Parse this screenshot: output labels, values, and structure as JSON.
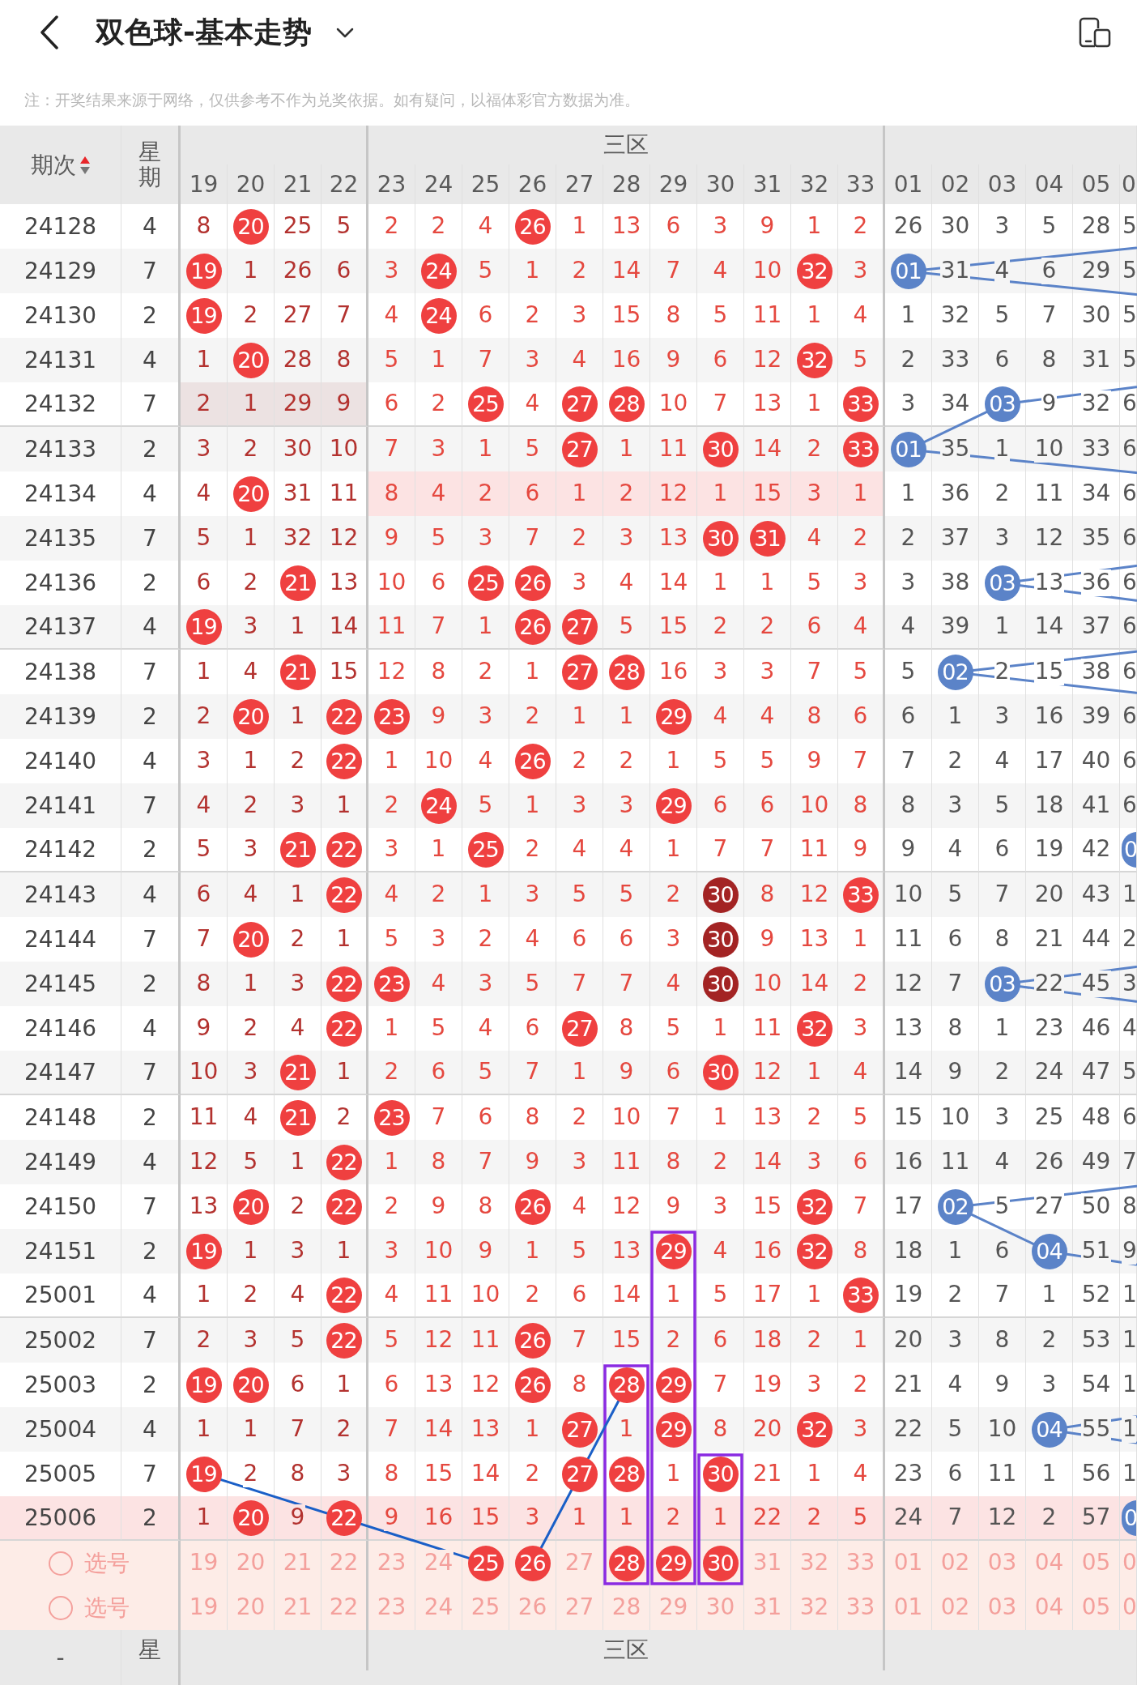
{
  "header": {
    "title": "双色球-基本走势"
  },
  "note": "注：开奖结果来源于网络，仅供参考不作为兑奖依据。如有疑问，以福体彩官方数据为准。",
  "table": {
    "columns": {
      "issue": "期次",
      "sort_ascending": true,
      "weekday": "星期",
      "zone": "三区",
      "red": [
        "19",
        "20",
        "21",
        "22",
        "23",
        "24",
        "25",
        "26",
        "27",
        "28",
        "29",
        "30",
        "31",
        "32",
        "33"
      ],
      "blue": [
        "01",
        "02",
        "03",
        "04",
        "05",
        "0"
      ]
    },
    "rows": [
      {
        "issue": "24128",
        "weekday": "4",
        "red": [
          "8",
          "20",
          "25",
          "5",
          "2",
          "2",
          "4",
          "26",
          "1",
          "13",
          "6",
          "3",
          "9",
          "1",
          "2"
        ],
        "red_hits": [
          false,
          true,
          false,
          false,
          false,
          false,
          false,
          true,
          false,
          false,
          false,
          false,
          false,
          false,
          false
        ],
        "blue": [
          "26",
          "30",
          "3",
          "5",
          "28",
          "5"
        ],
        "blue_hits": [
          false,
          false,
          false,
          false,
          false,
          false
        ],
        "highlight_a": false,
        "highlight_b": false,
        "highlight_row": false
      },
      {
        "issue": "24129",
        "weekday": "7",
        "red": [
          "19",
          "1",
          "26",
          "6",
          "3",
          "24",
          "5",
          "1",
          "2",
          "14",
          "7",
          "4",
          "10",
          "32",
          "3"
        ],
        "red_hits": [
          true,
          false,
          false,
          false,
          false,
          true,
          false,
          false,
          false,
          false,
          false,
          false,
          false,
          true,
          false
        ],
        "blue": [
          "01",
          "31",
          "4",
          "6",
          "29",
          "5"
        ],
        "blue_hits": [
          true,
          false,
          false,
          false,
          false,
          false
        ],
        "highlight_a": false,
        "highlight_b": false,
        "highlight_row": false
      },
      {
        "issue": "24130",
        "weekday": "2",
        "red": [
          "19",
          "2",
          "27",
          "7",
          "4",
          "24",
          "6",
          "2",
          "3",
          "15",
          "8",
          "5",
          "11",
          "1",
          "4"
        ],
        "red_hits": [
          true,
          false,
          false,
          false,
          false,
          true,
          false,
          false,
          false,
          false,
          false,
          false,
          false,
          false,
          false
        ],
        "blue": [
          "1",
          "32",
          "5",
          "7",
          "30",
          "5"
        ],
        "blue_hits": [
          false,
          false,
          false,
          false,
          false,
          false
        ],
        "highlight_a": false,
        "highlight_b": false,
        "highlight_row": false
      },
      {
        "issue": "24131",
        "weekday": "4",
        "red": [
          "1",
          "20",
          "28",
          "8",
          "5",
          "1",
          "7",
          "3",
          "4",
          "16",
          "9",
          "6",
          "12",
          "32",
          "5"
        ],
        "red_hits": [
          false,
          true,
          false,
          false,
          false,
          false,
          false,
          false,
          false,
          false,
          false,
          false,
          false,
          true,
          false
        ],
        "blue": [
          "2",
          "33",
          "6",
          "8",
          "31",
          "5"
        ],
        "blue_hits": [
          false,
          false,
          false,
          false,
          false,
          false
        ],
        "highlight_a": false,
        "highlight_b": false,
        "highlight_row": false
      },
      {
        "issue": "24132",
        "weekday": "7",
        "red": [
          "2",
          "1",
          "29",
          "9",
          "6",
          "2",
          "25",
          "4",
          "27",
          "28",
          "10",
          "7",
          "13",
          "1",
          "33"
        ],
        "red_hits": [
          false,
          false,
          false,
          false,
          false,
          false,
          true,
          false,
          true,
          true,
          false,
          false,
          false,
          false,
          true
        ],
        "blue": [
          "3",
          "34",
          "03",
          "9",
          "32",
          "6"
        ],
        "blue_hits": [
          false,
          false,
          true,
          false,
          false,
          false
        ],
        "highlight_a": true,
        "highlight_b": false,
        "highlight_row": false
      },
      {
        "issue": "24133",
        "weekday": "2",
        "red": [
          "3",
          "2",
          "30",
          "10",
          "7",
          "3",
          "1",
          "5",
          "27",
          "1",
          "11",
          "30",
          "14",
          "2",
          "33"
        ],
        "red_hits": [
          false,
          false,
          false,
          false,
          false,
          false,
          false,
          false,
          true,
          false,
          false,
          true,
          false,
          false,
          true
        ],
        "blue": [
          "01",
          "35",
          "1",
          "10",
          "33",
          "6"
        ],
        "blue_hits": [
          true,
          false,
          false,
          false,
          false,
          false
        ],
        "highlight_a": false,
        "highlight_b": false,
        "highlight_row": false
      },
      {
        "issue": "24134",
        "weekday": "4",
        "red": [
          "4",
          "20",
          "31",
          "11",
          "8",
          "4",
          "2",
          "6",
          "1",
          "2",
          "12",
          "1",
          "15",
          "3",
          "1"
        ],
        "red_hits": [
          false,
          true,
          false,
          false,
          false,
          false,
          false,
          false,
          false,
          false,
          false,
          false,
          false,
          false,
          false
        ],
        "blue": [
          "1",
          "36",
          "2",
          "11",
          "34",
          "6"
        ],
        "blue_hits": [
          false,
          false,
          false,
          false,
          false,
          false
        ],
        "highlight_a": false,
        "highlight_b": true,
        "highlight_row": false
      },
      {
        "issue": "24135",
        "weekday": "7",
        "red": [
          "5",
          "1",
          "32",
          "12",
          "9",
          "5",
          "3",
          "7",
          "2",
          "3",
          "13",
          "30",
          "31",
          "4",
          "2"
        ],
        "red_hits": [
          false,
          false,
          false,
          false,
          false,
          false,
          false,
          false,
          false,
          false,
          false,
          true,
          true,
          false,
          false
        ],
        "blue": [
          "2",
          "37",
          "3",
          "12",
          "35",
          "6"
        ],
        "blue_hits": [
          false,
          false,
          false,
          false,
          false,
          false
        ],
        "highlight_a": false,
        "highlight_b": false,
        "highlight_row": false
      },
      {
        "issue": "24136",
        "weekday": "2",
        "red": [
          "6",
          "2",
          "21",
          "13",
          "10",
          "6",
          "25",
          "26",
          "3",
          "4",
          "14",
          "1",
          "1",
          "5",
          "3"
        ],
        "red_hits": [
          false,
          false,
          true,
          false,
          false,
          false,
          true,
          true,
          false,
          false,
          false,
          false,
          false,
          false,
          false
        ],
        "blue": [
          "3",
          "38",
          "03",
          "13",
          "36",
          "6"
        ],
        "blue_hits": [
          false,
          false,
          true,
          false,
          false,
          false
        ],
        "highlight_a": false,
        "highlight_b": false,
        "highlight_row": false
      },
      {
        "issue": "24137",
        "weekday": "4",
        "red": [
          "19",
          "3",
          "1",
          "14",
          "11",
          "7",
          "1",
          "26",
          "27",
          "5",
          "15",
          "2",
          "2",
          "6",
          "4"
        ],
        "red_hits": [
          true,
          false,
          false,
          false,
          false,
          false,
          false,
          true,
          true,
          false,
          false,
          false,
          false,
          false,
          false
        ],
        "blue": [
          "4",
          "39",
          "1",
          "14",
          "37",
          "6"
        ],
        "blue_hits": [
          false,
          false,
          false,
          false,
          false,
          false
        ],
        "highlight_a": false,
        "highlight_b": false,
        "highlight_row": false
      },
      {
        "issue": "24138",
        "weekday": "7",
        "red": [
          "1",
          "4",
          "21",
          "15",
          "12",
          "8",
          "2",
          "1",
          "27",
          "28",
          "16",
          "3",
          "3",
          "7",
          "5"
        ],
        "red_hits": [
          false,
          false,
          true,
          false,
          false,
          false,
          false,
          false,
          true,
          true,
          false,
          false,
          false,
          false,
          false
        ],
        "blue": [
          "5",
          "02",
          "2",
          "15",
          "38",
          "6"
        ],
        "blue_hits": [
          false,
          true,
          false,
          false,
          false,
          false
        ],
        "highlight_a": false,
        "highlight_b": false,
        "highlight_row": false
      },
      {
        "issue": "24139",
        "weekday": "2",
        "red": [
          "2",
          "20",
          "1",
          "22",
          "23",
          "9",
          "3",
          "2",
          "1",
          "1",
          "29",
          "4",
          "4",
          "8",
          "6"
        ],
        "red_hits": [
          false,
          true,
          false,
          true,
          true,
          false,
          false,
          false,
          false,
          false,
          true,
          false,
          false,
          false,
          false
        ],
        "blue": [
          "6",
          "1",
          "3",
          "16",
          "39",
          "6"
        ],
        "blue_hits": [
          false,
          false,
          false,
          false,
          false,
          false
        ],
        "highlight_a": false,
        "highlight_b": false,
        "highlight_row": false
      },
      {
        "issue": "24140",
        "weekday": "4",
        "red": [
          "3",
          "1",
          "2",
          "22",
          "1",
          "10",
          "4",
          "26",
          "2",
          "2",
          "1",
          "5",
          "5",
          "9",
          "7"
        ],
        "red_hits": [
          false,
          false,
          false,
          true,
          false,
          false,
          false,
          true,
          false,
          false,
          false,
          false,
          false,
          false,
          false
        ],
        "blue": [
          "7",
          "2",
          "4",
          "17",
          "40",
          "6"
        ],
        "blue_hits": [
          false,
          false,
          false,
          false,
          false,
          false
        ],
        "highlight_a": false,
        "highlight_b": false,
        "highlight_row": false
      },
      {
        "issue": "24141",
        "weekday": "7",
        "red": [
          "4",
          "2",
          "3",
          "1",
          "2",
          "24",
          "5",
          "1",
          "3",
          "3",
          "29",
          "6",
          "6",
          "10",
          "8"
        ],
        "red_hits": [
          false,
          false,
          false,
          false,
          false,
          true,
          false,
          false,
          false,
          false,
          true,
          false,
          false,
          false,
          false
        ],
        "blue": [
          "8",
          "3",
          "5",
          "18",
          "41",
          "6"
        ],
        "blue_hits": [
          false,
          false,
          false,
          false,
          false,
          false
        ],
        "highlight_a": false,
        "highlight_b": false,
        "highlight_row": false
      },
      {
        "issue": "24142",
        "weekday": "2",
        "red": [
          "5",
          "3",
          "21",
          "22",
          "3",
          "1",
          "25",
          "2",
          "4",
          "4",
          "1",
          "7",
          "7",
          "11",
          "9"
        ],
        "red_hits": [
          false,
          false,
          true,
          true,
          false,
          false,
          true,
          false,
          false,
          false,
          false,
          false,
          false,
          false,
          false
        ],
        "blue": [
          "9",
          "4",
          "6",
          "19",
          "42",
          "0"
        ],
        "blue_hits": [
          false,
          false,
          false,
          false,
          false,
          true
        ],
        "highlight_a": false,
        "highlight_b": false,
        "highlight_row": false
      },
      {
        "issue": "24143",
        "weekday": "4",
        "red": [
          "6",
          "4",
          "1",
          "22",
          "4",
          "2",
          "1",
          "3",
          "5",
          "5",
          "2",
          "30",
          "8",
          "12",
          "33"
        ],
        "red_hits": [
          false,
          false,
          false,
          true,
          false,
          false,
          false,
          false,
          false,
          false,
          false,
          true,
          false,
          false,
          true
        ],
        "blue": [
          "10",
          "5",
          "7",
          "20",
          "43",
          "1"
        ],
        "blue_hits": [
          false,
          false,
          false,
          false,
          false,
          false
        ],
        "highlight_a": false,
        "highlight_b": false,
        "highlight_row": false
      },
      {
        "issue": "24144",
        "weekday": "7",
        "red": [
          "7",
          "20",
          "2",
          "1",
          "5",
          "3",
          "2",
          "4",
          "6",
          "6",
          "3",
          "30",
          "9",
          "13",
          "1"
        ],
        "red_hits": [
          false,
          true,
          false,
          false,
          false,
          false,
          false,
          false,
          false,
          false,
          false,
          true,
          false,
          false,
          false
        ],
        "blue": [
          "11",
          "6",
          "8",
          "21",
          "44",
          "2"
        ],
        "blue_hits": [
          false,
          false,
          false,
          false,
          false,
          false
        ],
        "highlight_a": false,
        "highlight_b": false,
        "highlight_row": false
      },
      {
        "issue": "24145",
        "weekday": "2",
        "red": [
          "8",
          "1",
          "3",
          "22",
          "23",
          "4",
          "3",
          "5",
          "7",
          "7",
          "4",
          "30",
          "10",
          "14",
          "2"
        ],
        "red_hits": [
          false,
          false,
          false,
          true,
          true,
          false,
          false,
          false,
          false,
          false,
          false,
          true,
          false,
          false,
          false
        ],
        "blue": [
          "12",
          "7",
          "03",
          "22",
          "45",
          "3"
        ],
        "blue_hits": [
          false,
          false,
          true,
          false,
          false,
          false
        ],
        "highlight_a": false,
        "highlight_b": false,
        "highlight_row": false
      },
      {
        "issue": "24146",
        "weekday": "4",
        "red": [
          "9",
          "2",
          "4",
          "22",
          "1",
          "5",
          "4",
          "6",
          "27",
          "8",
          "5",
          "1",
          "11",
          "32",
          "3"
        ],
        "red_hits": [
          false,
          false,
          false,
          true,
          false,
          false,
          false,
          false,
          true,
          false,
          false,
          false,
          false,
          true,
          false
        ],
        "blue": [
          "13",
          "8",
          "1",
          "23",
          "46",
          "4"
        ],
        "blue_hits": [
          false,
          false,
          false,
          false,
          false,
          false
        ],
        "highlight_a": false,
        "highlight_b": false,
        "highlight_row": false
      },
      {
        "issue": "24147",
        "weekday": "7",
        "red": [
          "10",
          "3",
          "21",
          "1",
          "2",
          "6",
          "5",
          "7",
          "1",
          "9",
          "6",
          "30",
          "12",
          "1",
          "4"
        ],
        "red_hits": [
          false,
          false,
          true,
          false,
          false,
          false,
          false,
          false,
          false,
          false,
          false,
          true,
          false,
          false,
          false
        ],
        "blue": [
          "14",
          "9",
          "2",
          "24",
          "47",
          "5"
        ],
        "blue_hits": [
          false,
          false,
          false,
          false,
          false,
          false
        ],
        "highlight_a": false,
        "highlight_b": false,
        "highlight_row": false
      },
      {
        "issue": "24148",
        "weekday": "2",
        "red": [
          "11",
          "4",
          "21",
          "2",
          "23",
          "7",
          "6",
          "8",
          "2",
          "10",
          "7",
          "1",
          "13",
          "2",
          "5"
        ],
        "red_hits": [
          false,
          false,
          true,
          false,
          true,
          false,
          false,
          false,
          false,
          false,
          false,
          false,
          false,
          false,
          false
        ],
        "blue": [
          "15",
          "10",
          "3",
          "25",
          "48",
          "6"
        ],
        "blue_hits": [
          false,
          false,
          false,
          false,
          false,
          false
        ],
        "highlight_a": false,
        "highlight_b": false,
        "highlight_row": false
      },
      {
        "issue": "24149",
        "weekday": "4",
        "red": [
          "12",
          "5",
          "1",
          "22",
          "1",
          "8",
          "7",
          "9",
          "3",
          "11",
          "8",
          "2",
          "14",
          "3",
          "6"
        ],
        "red_hits": [
          false,
          false,
          false,
          true,
          false,
          false,
          false,
          false,
          false,
          false,
          false,
          false,
          false,
          false,
          false
        ],
        "blue": [
          "16",
          "11",
          "4",
          "26",
          "49",
          "7"
        ],
        "blue_hits": [
          false,
          false,
          false,
          false,
          false,
          false
        ],
        "highlight_a": false,
        "highlight_b": false,
        "highlight_row": false
      },
      {
        "issue": "24150",
        "weekday": "7",
        "red": [
          "13",
          "20",
          "2",
          "22",
          "2",
          "9",
          "8",
          "26",
          "4",
          "12",
          "9",
          "3",
          "15",
          "32",
          "7"
        ],
        "red_hits": [
          false,
          true,
          false,
          true,
          false,
          false,
          false,
          true,
          false,
          false,
          false,
          false,
          false,
          true,
          false
        ],
        "blue": [
          "17",
          "02",
          "5",
          "27",
          "50",
          "8"
        ],
        "blue_hits": [
          false,
          true,
          false,
          false,
          false,
          false
        ],
        "highlight_a": false,
        "highlight_b": false,
        "highlight_row": false
      },
      {
        "issue": "24151",
        "weekday": "2",
        "red": [
          "19",
          "1",
          "3",
          "1",
          "3",
          "10",
          "9",
          "1",
          "5",
          "13",
          "29",
          "4",
          "16",
          "32",
          "8"
        ],
        "red_hits": [
          true,
          false,
          false,
          false,
          false,
          false,
          false,
          false,
          false,
          false,
          true,
          false,
          false,
          true,
          false
        ],
        "blue": [
          "18",
          "1",
          "6",
          "04",
          "51",
          "9"
        ],
        "blue_hits": [
          false,
          false,
          false,
          true,
          false,
          false
        ],
        "highlight_a": false,
        "highlight_b": false,
        "highlight_row": false
      },
      {
        "issue": "25001",
        "weekday": "4",
        "red": [
          "1",
          "2",
          "4",
          "22",
          "4",
          "11",
          "10",
          "2",
          "6",
          "14",
          "1",
          "5",
          "17",
          "1",
          "33"
        ],
        "red_hits": [
          false,
          false,
          false,
          true,
          false,
          false,
          false,
          false,
          false,
          false,
          false,
          false,
          false,
          false,
          true
        ],
        "blue": [
          "19",
          "2",
          "7",
          "1",
          "52",
          "1"
        ],
        "blue_hits": [
          false,
          false,
          false,
          false,
          false,
          false
        ],
        "highlight_a": false,
        "highlight_b": false,
        "highlight_row": false
      },
      {
        "issue": "25002",
        "weekday": "7",
        "red": [
          "2",
          "3",
          "5",
          "22",
          "5",
          "12",
          "11",
          "26",
          "7",
          "15",
          "2",
          "6",
          "18",
          "2",
          "1"
        ],
        "red_hits": [
          false,
          false,
          false,
          true,
          false,
          false,
          false,
          true,
          false,
          false,
          false,
          false,
          false,
          false,
          false
        ],
        "blue": [
          "20",
          "3",
          "8",
          "2",
          "53",
          "1"
        ],
        "blue_hits": [
          false,
          false,
          false,
          false,
          false,
          false
        ],
        "highlight_a": false,
        "highlight_b": false,
        "highlight_row": false
      },
      {
        "issue": "25003",
        "weekday": "2",
        "red": [
          "19",
          "20",
          "6",
          "1",
          "6",
          "13",
          "12",
          "26",
          "8",
          "28",
          "29",
          "7",
          "19",
          "3",
          "2"
        ],
        "red_hits": [
          true,
          true,
          false,
          false,
          false,
          false,
          false,
          true,
          false,
          true,
          true,
          false,
          false,
          false,
          false
        ],
        "blue": [
          "21",
          "4",
          "9",
          "3",
          "54",
          "1"
        ],
        "blue_hits": [
          false,
          false,
          false,
          false,
          false,
          false
        ],
        "highlight_a": false,
        "highlight_b": false,
        "highlight_row": false
      },
      {
        "issue": "25004",
        "weekday": "4",
        "red": [
          "1",
          "1",
          "7",
          "2",
          "7",
          "14",
          "13",
          "1",
          "27",
          "1",
          "29",
          "8",
          "20",
          "32",
          "3"
        ],
        "red_hits": [
          false,
          false,
          false,
          false,
          false,
          false,
          false,
          false,
          true,
          false,
          true,
          false,
          false,
          true,
          false
        ],
        "blue": [
          "22",
          "5",
          "10",
          "04",
          "55",
          "1"
        ],
        "blue_hits": [
          false,
          false,
          false,
          true,
          false,
          false
        ],
        "highlight_a": false,
        "highlight_b": false,
        "highlight_row": false
      },
      {
        "issue": "25005",
        "weekday": "7",
        "red": [
          "19",
          "2",
          "8",
          "3",
          "8",
          "15",
          "14",
          "2",
          "27",
          "28",
          "1",
          "30",
          "21",
          "1",
          "4"
        ],
        "red_hits": [
          true,
          false,
          false,
          false,
          false,
          false,
          false,
          false,
          true,
          true,
          false,
          true,
          false,
          false,
          false
        ],
        "blue": [
          "23",
          "6",
          "11",
          "1",
          "56",
          "1"
        ],
        "blue_hits": [
          false,
          false,
          false,
          false,
          false,
          false
        ],
        "highlight_a": false,
        "highlight_b": false,
        "highlight_row": false
      },
      {
        "issue": "25006",
        "weekday": "2",
        "red": [
          "1",
          "20",
          "9",
          "22",
          "9",
          "16",
          "15",
          "3",
          "1",
          "1",
          "2",
          "1",
          "22",
          "2",
          "5"
        ],
        "red_hits": [
          false,
          true,
          false,
          true,
          false,
          false,
          false,
          false,
          false,
          false,
          false,
          false,
          false,
          false,
          false
        ],
        "blue": [
          "24",
          "7",
          "12",
          "2",
          "57",
          "0"
        ],
        "blue_hits": [
          false,
          false,
          false,
          false,
          false,
          true
        ],
        "highlight_a": false,
        "highlight_b": false,
        "highlight_row": true
      }
    ],
    "pick_rows": [
      {
        "label": "选号",
        "selected": false,
        "red": [
          "19",
          "20",
          "21",
          "22",
          "23",
          "24",
          "25",
          "26",
          "27",
          "28",
          "29",
          "30",
          "31",
          "32",
          "33"
        ],
        "red_selected": [
          false,
          false,
          false,
          false,
          false,
          false,
          true,
          true,
          false,
          true,
          true,
          true,
          false,
          false,
          false
        ],
        "blue": [
          "01",
          "02",
          "03",
          "04",
          "05",
          "0"
        ],
        "blue_selected": [
          false,
          false,
          false,
          false,
          false,
          false
        ]
      },
      {
        "label": "选号",
        "selected": false,
        "red": [
          "19",
          "20",
          "21",
          "22",
          "23",
          "24",
          "25",
          "26",
          "27",
          "28",
          "29",
          "30",
          "31",
          "32",
          "33"
        ],
        "red_selected": [
          false,
          false,
          false,
          false,
          false,
          false,
          false,
          false,
          false,
          false,
          false,
          false,
          false,
          false,
          false
        ],
        "blue": [
          "01",
          "02",
          "03",
          "04",
          "05",
          "0"
        ],
        "blue_selected": [
          false,
          false,
          false,
          false,
          false,
          false
        ]
      }
    ],
    "footer": {
      "issue": "-",
      "weekday": "星",
      "zone": "三区"
    }
  }
}
